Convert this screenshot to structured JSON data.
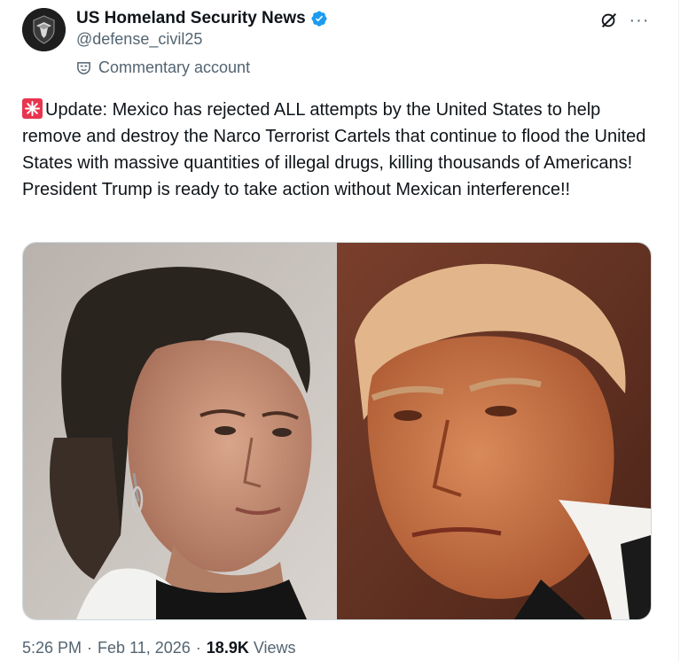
{
  "author": {
    "display_name": "US Homeland Security News",
    "handle": "@defense_civil25",
    "label": "Commentary account",
    "verified": true,
    "verified_color": "#1d9bf0"
  },
  "actions": {
    "grok_icon": "grok-icon",
    "more_icon": "more-icon",
    "more_label": "···"
  },
  "tweet": {
    "emoji": "siren-emoji",
    "text": "Update: Mexico has rejected ALL attempts by the United States to help remove and destroy the Narco Terrorist Cartels that continue to flood the United States with massive quantities of illegal drugs, killing thousands of Americans! President Trump is ready to take action without Mexican interference!!"
  },
  "media": {
    "left_photo": "woman-portrait-photo",
    "right_photo": "man-portrait-photo"
  },
  "meta": {
    "time": "5:26 PM",
    "dot1": "·",
    "date": "Feb 11, 2026",
    "dot2": "·",
    "views_count": "18.9K",
    "views_label": "Views"
  }
}
